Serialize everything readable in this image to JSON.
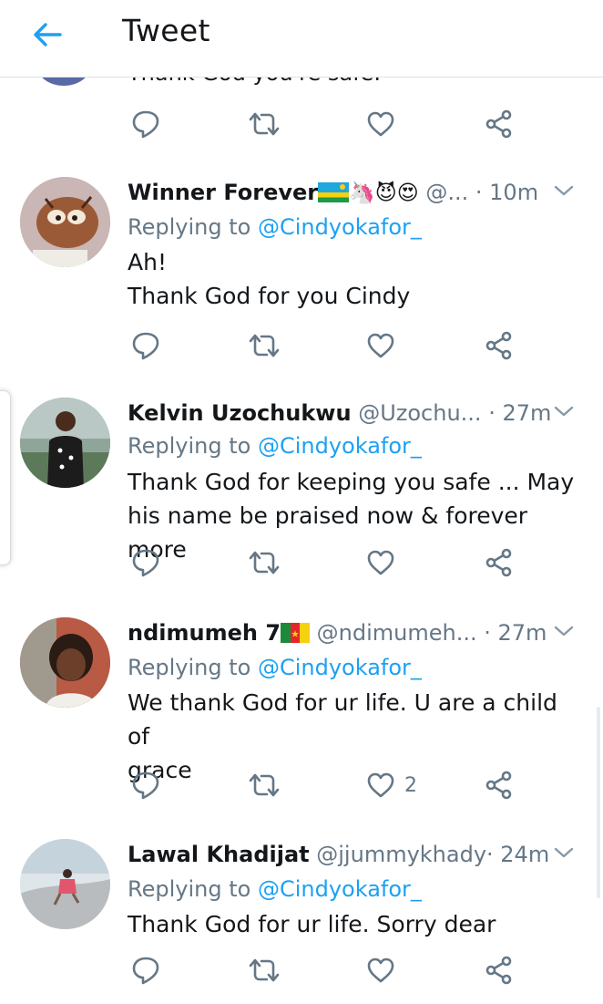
{
  "header": {
    "title": "Tweet"
  },
  "prev_fragment": {
    "text": "Thank God you're safe."
  },
  "tweets": [
    {
      "name": "Winner Forever",
      "name_emoji": "🦄😈😍",
      "handle": "@...",
      "time": "· 10m",
      "replying_to_prefix": "Replying to",
      "replying_to": "@Cindyokafor_",
      "body": [
        "Ah!",
        "Thank God for you Cindy"
      ],
      "likes": ""
    },
    {
      "name": "Kelvin Uzochukwu",
      "name_emoji": "",
      "handle": "@Uzochu...",
      "time": "· 27m",
      "replying_to_prefix": "Replying to",
      "replying_to": "@Cindyokafor_",
      "body": [
        "Thank God for keeping you safe ... May",
        "his name be praised now & forever more"
      ],
      "likes": ""
    },
    {
      "name": "ndimumeh 7",
      "name_emoji": "",
      "handle": "@ndimumeh...",
      "time": "· 27m",
      "replying_to_prefix": "Replying to",
      "replying_to": "@Cindyokafor_",
      "body": [
        "We thank God for ur life. U are a child of",
        "grace"
      ],
      "likes": "2"
    },
    {
      "name": "Lawal Khadijat",
      "name_emoji": "",
      "handle": "@jjummykhady",
      "time": "· 24m",
      "replying_to_prefix": "Replying to",
      "replying_to": "@Cindyokafor_",
      "body": [
        "Thank God for ur life. Sorry dear"
      ],
      "likes": ""
    }
  ],
  "colors": {
    "accent": "#1da1f2",
    "secondary_text": "#657786",
    "primary_text": "#14171a",
    "divider": "#e1e6ea"
  },
  "icons": [
    "back-arrow-icon",
    "reply-icon",
    "retweet-icon",
    "like-icon",
    "share-icon",
    "chevron-down-icon",
    "rwanda-flag-icon",
    "cameroon-flag-icon"
  ]
}
